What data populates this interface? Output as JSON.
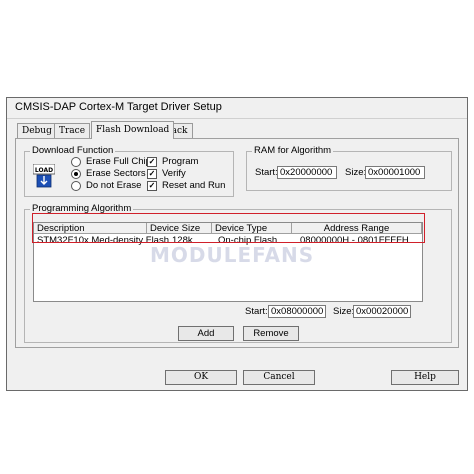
{
  "window": {
    "title": "CMSIS-DAP Cortex-M Target Driver Setup"
  },
  "tabs": [
    {
      "label": "Debug"
    },
    {
      "label": "Trace"
    },
    {
      "label": "Flash Download"
    },
    {
      "label": "Pack"
    }
  ],
  "download_function": {
    "label": "Download Function",
    "icon_text": "LOAD",
    "radios": [
      {
        "label": "Erase Full Chip",
        "selected": false
      },
      {
        "label": "Erase Sectors",
        "selected": true
      },
      {
        "label": "Do not Erase",
        "selected": false
      }
    ],
    "checks": [
      {
        "label": "Program",
        "checked": true
      },
      {
        "label": "Verify",
        "checked": true
      },
      {
        "label": "Reset and Run",
        "checked": true
      }
    ]
  },
  "ram": {
    "label": "RAM for Algorithm",
    "start_label": "Start:",
    "start_value": "0x20000000",
    "size_label": "Size:",
    "size_value": "0x00001000"
  },
  "algorithm": {
    "label": "Programming Algorithm",
    "columns": [
      "Description",
      "Device Size",
      "Device Type",
      "Address Range"
    ],
    "rows": [
      [
        "STM32F10x Med-density Flash",
        "128k",
        "On-chip Flash",
        "08000000H - 0801FFFFH"
      ]
    ],
    "start_label": "Start:",
    "start_value": "0x08000000",
    "size_label": "Size:",
    "size_value": "0x00020000",
    "add_label": "Add",
    "remove_label": "Remove"
  },
  "footer": {
    "ok_label": "OK",
    "cancel_label": "Cancel",
    "help_label": "Help"
  },
  "watermark": "MODULEFANS",
  "colors": {
    "highlight": "#d0202a",
    "dialog_bg": "#f0f0f0"
  }
}
